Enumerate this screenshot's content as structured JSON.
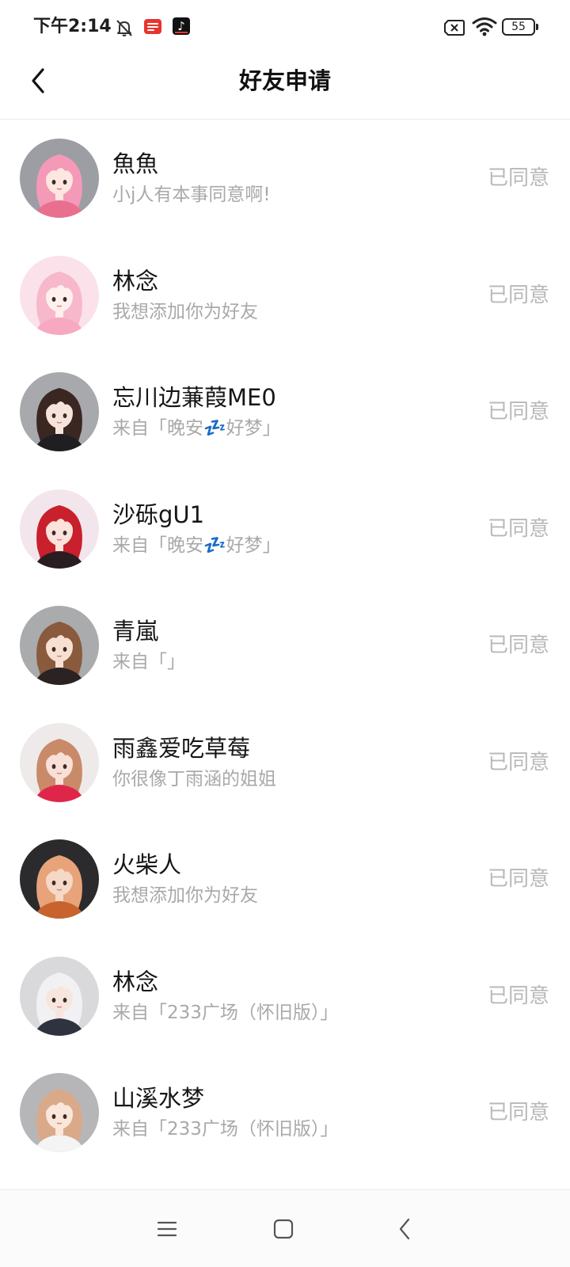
{
  "status_bar": {
    "time": "下午2:14",
    "battery": "55",
    "icons_left": [
      "bell-off-icon",
      "app-notification-icon",
      "tiktok-icon"
    ],
    "icons_right": [
      "no-sim-icon",
      "wifi-icon",
      "battery-icon"
    ]
  },
  "header": {
    "title": "好友申请",
    "back_icon": "chevron-left-icon"
  },
  "friend_requests": [
    {
      "name": "魚魚",
      "message": "小j人有本事同意啊!",
      "status": "已同意",
      "avatar": {
        "bg": "#9c9ea3",
        "hair": "#f49ab8",
        "skin": "#fde7e0",
        "body": "#e8708e"
      }
    },
    {
      "name": "林念",
      "message": "我想添加你为好友",
      "status": "已同意",
      "avatar": {
        "bg": "#fbe2ea",
        "hair": "#f7b8cb",
        "skin": "#fff0ee",
        "body": "#f6a9c0"
      }
    },
    {
      "name": "忘川边蒹葭ME0",
      "message": "来自「晚安💤好梦」",
      "status": "已同意",
      "avatar": {
        "bg": "#a7a9ad",
        "hair": "#3a2722",
        "skin": "#f6e4da",
        "body": "#1f1f22"
      }
    },
    {
      "name": "沙砾gU1",
      "message": "来自「晚安💤好梦」",
      "status": "已同意",
      "avatar": {
        "bg": "#f2e6ec",
        "hair": "#c8202c",
        "skin": "#fbe3dc",
        "body": "#2a1d22"
      }
    },
    {
      "name": "青嵐",
      "message": "来自「」",
      "status": "已同意",
      "avatar": {
        "bg": "#a9abad",
        "hair": "#8a5a3c",
        "skin": "#f7e0d2",
        "body": "#2b2223"
      }
    },
    {
      "name": "雨鑫爱吃草莓",
      "message": "你很像丁雨涵的姐姐",
      "status": "已同意",
      "avatar": {
        "bg": "#efeaea",
        "hair": "#c98a6a",
        "skin": "#f8e0d6",
        "body": "#e0254a"
      }
    },
    {
      "name": "火柴人",
      "message": "我想添加你为好友",
      "status": "已同意",
      "avatar": {
        "bg": "#2b2b2d",
        "hair": "#e8a37a",
        "skin": "#f5d8c6",
        "body": "#c8632d"
      }
    },
    {
      "name": "林念",
      "message": "来自「233广场（怀旧版）」",
      "status": "已同意",
      "avatar": {
        "bg": "#d9d9db",
        "hair": "#f1f1f3",
        "skin": "#f7e6de",
        "body": "#2f3340"
      }
    },
    {
      "name": "山溪水梦",
      "message": "来自「233广场（怀旧版）」",
      "status": "已同意",
      "avatar": {
        "bg": "#b6b6b8",
        "hair": "#d9a98a",
        "skin": "#fbe6da",
        "body": "#f4f4f4"
      }
    }
  ],
  "nav_bar": {
    "icons": [
      "menu-icon",
      "home-square-icon",
      "back-chevron-icon"
    ]
  },
  "colors": {
    "name_text": "#161616",
    "message_text": "#a9a9a9",
    "status_text": "#b8b8b8",
    "divider": "#ebebeb"
  }
}
